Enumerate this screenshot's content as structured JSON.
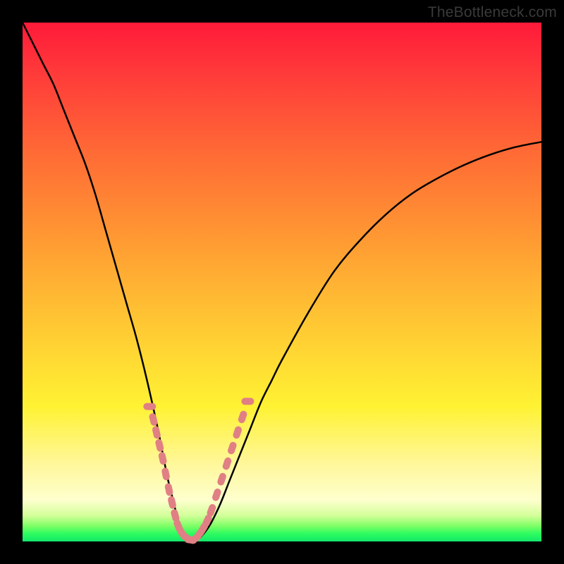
{
  "watermark": "TheBottleneck.com",
  "colors": {
    "gradient_top": "#ff1a3a",
    "gradient_mid": "#fff233",
    "gradient_bottom": "#12e86a",
    "curve": "#000000",
    "marker": "#e08084"
  },
  "chart_data": {
    "type": "line",
    "title": "",
    "xlabel": "",
    "ylabel": "",
    "xlim": [
      0,
      100
    ],
    "ylim": [
      0,
      100
    ],
    "grid": false,
    "legend": false,
    "series": [
      {
        "name": "bottleneck-curve",
        "x": [
          0,
          2,
          4,
          6,
          8,
          10,
          12,
          14,
          16,
          18,
          20,
          22,
          24,
          26,
          27,
          28,
          29,
          30,
          31,
          32,
          33,
          34,
          36,
          38,
          40,
          42,
          44,
          46,
          48,
          50,
          55,
          60,
          65,
          70,
          75,
          80,
          85,
          90,
          95,
          100
        ],
        "y": [
          100,
          96,
          92,
          88,
          83,
          78,
          73,
          67,
          60,
          53,
          46,
          39,
          31,
          22,
          17,
          12,
          8,
          4,
          2,
          0.5,
          0,
          0.5,
          3,
          7,
          12,
          17,
          22,
          27,
          31,
          35,
          44,
          52,
          58,
          63,
          67,
          70,
          72.5,
          74.5,
          76,
          77
        ]
      }
    ],
    "markers": {
      "name": "highlight-segments",
      "x": [
        24.5,
        25.2,
        25.8,
        26.4,
        27.0,
        27.6,
        28.2,
        28.8,
        29.4,
        30.0,
        30.8,
        31.6,
        32.4,
        33.2,
        34.0,
        34.8,
        35.6,
        36.4,
        37.4,
        38.4,
        39.4,
        40.4,
        41.4,
        42.4,
        43.4
      ],
      "y": [
        26,
        23.5,
        21,
        18.5,
        16,
        13,
        10,
        7.5,
        5,
        3,
        1.5,
        0.7,
        0.3,
        0.5,
        1.3,
        2.5,
        4,
        6,
        9,
        12,
        15,
        18,
        21,
        24,
        27
      ]
    }
  }
}
